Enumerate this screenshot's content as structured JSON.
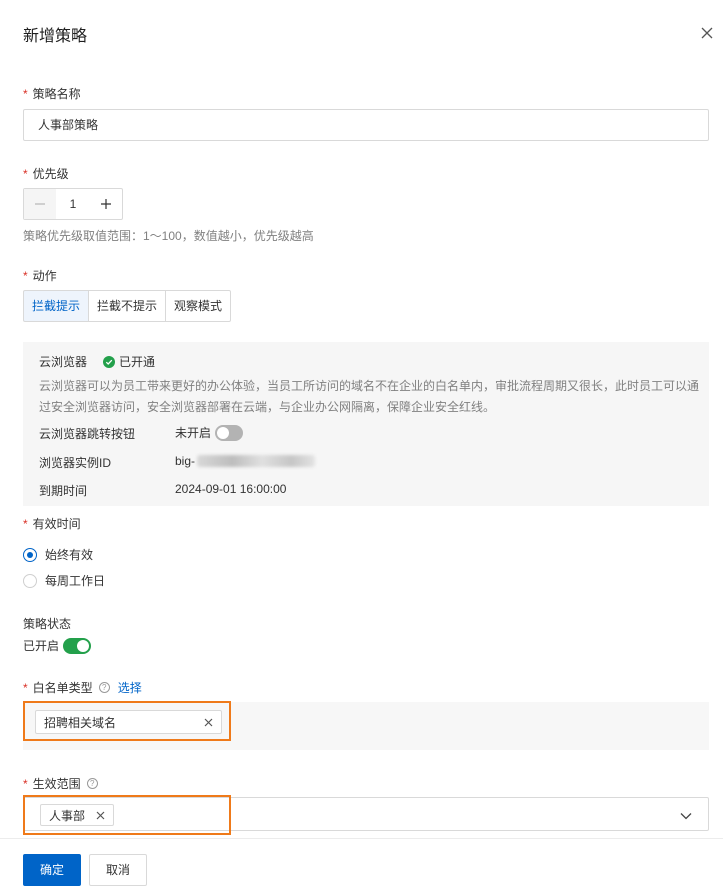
{
  "dialog": {
    "title": "新增策略"
  },
  "required_mark": "*",
  "policy_name": {
    "label": "策略名称",
    "value": "人事部策略"
  },
  "priority": {
    "label": "优先级",
    "value": "1",
    "decrement": "−",
    "increment": "+",
    "hint": "策略优先级取值范围：1～100，数值越小，优先级越高"
  },
  "action": {
    "label": "动作",
    "options": [
      "拦截提示",
      "拦截不提示",
      "观察模式"
    ],
    "selected": "拦截提示"
  },
  "cloud_browser": {
    "title": "云浏览器",
    "status": "已开通",
    "description": "云浏览器可以为员工带来更好的办公体验，当员工所访问的域名不在企业的白名单内，审批流程周期又很长，此时员工可以通过安全浏览器访问，安全浏览器部署在云端，与企业办公网隔离，保障企业安全红线。",
    "jump_button_label": "云浏览器跳转按钮",
    "jump_button_value": "未开启",
    "instance_id_label": "浏览器实例ID",
    "instance_id_value": "big-",
    "expire_label": "到期时间",
    "expire_value": "2024-09-01 16:00:00"
  },
  "effective_time": {
    "label": "有效时间",
    "options": [
      "始终有效",
      "每周工作日"
    ],
    "selected": "始终有效"
  },
  "policy_status": {
    "label": "策略状态",
    "value": "已开启",
    "enabled": true
  },
  "whitelist": {
    "label": "白名单类型",
    "select_link": "选择",
    "tags": [
      "招聘相关域名"
    ]
  },
  "scope": {
    "label": "生效范围",
    "tags": [
      "人事部"
    ]
  },
  "footer": {
    "confirm": "确定",
    "cancel": "取消"
  },
  "colors": {
    "primary": "#0064c8",
    "success": "#23a04b",
    "highlight": "#ef7a1a",
    "required": "#d93026"
  },
  "icons": [
    "close-icon",
    "minus-icon",
    "plus-icon",
    "check-circle-icon",
    "help-icon",
    "tag-close-icon",
    "chevron-down-icon"
  ]
}
